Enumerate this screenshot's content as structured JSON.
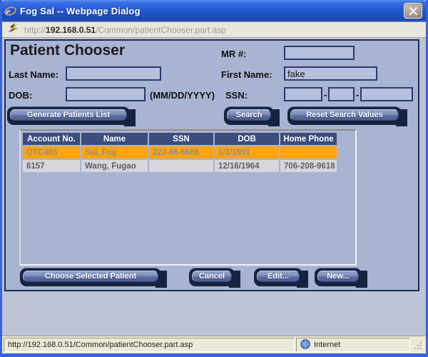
{
  "window": {
    "title": "Fog Sal -- Webpage Dialog"
  },
  "address_bar": {
    "protocol": "http://",
    "host": "192.168.0.51",
    "path": "/Common/patientChooser.part.asp"
  },
  "panel": {
    "title": "Patient Chooser",
    "labels": {
      "mr": "MR #:",
      "last_name": "Last Name:",
      "first_name": "First Name:",
      "dob": "DOB:",
      "dob_hint": "(MM/DD/YYYY)",
      "ssn": "SSN:",
      "ssn_dash1": "-",
      "ssn_dash2": "-"
    },
    "values": {
      "mr": "",
      "last_name": "",
      "first_name": "fake",
      "dob": "",
      "ssn1": "",
      "ssn2": "",
      "ssn3": ""
    },
    "search_buttons": {
      "generate": "Generate Patients List",
      "search": "Search",
      "reset": "Reset Search Values"
    },
    "action_buttons": {
      "choose": "Choose Selected Patient",
      "cancel": "Cancel",
      "edit": "Edit...",
      "new": "New..."
    }
  },
  "patient_table": {
    "headers": [
      "Account No.",
      "Name",
      "SSN",
      "DOB",
      "Home Phone"
    ],
    "rows": [
      {
        "account_no": "OTC485",
        "name": "Sal, Fog",
        "ssn": "222-66-6666",
        "dob": "1/1/1991",
        "home_phone": "",
        "selected": true
      },
      {
        "account_no": "6157",
        "name": "Wang, Fugao",
        "ssn": "",
        "dob": "12/16/1964",
        "home_phone": "706-208-9618",
        "selected": false
      }
    ]
  },
  "status_bar": {
    "url": "http://192.168.0.51/Common/patientChooser.part.asp",
    "zone_label": "Internet"
  },
  "colors": {
    "selected_row": "#FFA40A",
    "row_alt_bg": "#D6D6DC",
    "table_header_bg": "#3C4C7C",
    "panel_bg": "#A9B4D2",
    "button_dark_navy": "#16233F",
    "titlebar_blue": "#2459D2",
    "window_border_blue": "#3563DD",
    "status_bar_bg": "#ECE9D8"
  }
}
